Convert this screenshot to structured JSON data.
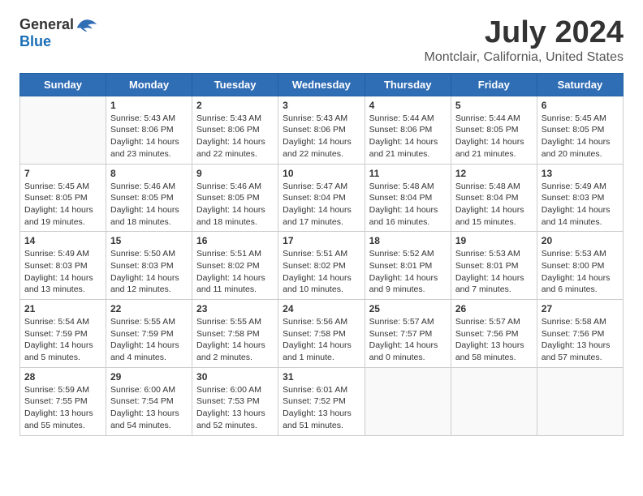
{
  "logo": {
    "general": "General",
    "blue": "Blue"
  },
  "title": "July 2024",
  "location": "Montclair, California, United States",
  "days_of_week": [
    "Sunday",
    "Monday",
    "Tuesday",
    "Wednesday",
    "Thursday",
    "Friday",
    "Saturday"
  ],
  "weeks": [
    [
      {
        "day": "",
        "info": ""
      },
      {
        "day": "1",
        "info": "Sunrise: 5:43 AM\nSunset: 8:06 PM\nDaylight: 14 hours\nand 23 minutes."
      },
      {
        "day": "2",
        "info": "Sunrise: 5:43 AM\nSunset: 8:06 PM\nDaylight: 14 hours\nand 22 minutes."
      },
      {
        "day": "3",
        "info": "Sunrise: 5:43 AM\nSunset: 8:06 PM\nDaylight: 14 hours\nand 22 minutes."
      },
      {
        "day": "4",
        "info": "Sunrise: 5:44 AM\nSunset: 8:06 PM\nDaylight: 14 hours\nand 21 minutes."
      },
      {
        "day": "5",
        "info": "Sunrise: 5:44 AM\nSunset: 8:05 PM\nDaylight: 14 hours\nand 21 minutes."
      },
      {
        "day": "6",
        "info": "Sunrise: 5:45 AM\nSunset: 8:05 PM\nDaylight: 14 hours\nand 20 minutes."
      }
    ],
    [
      {
        "day": "7",
        "info": "Sunrise: 5:45 AM\nSunset: 8:05 PM\nDaylight: 14 hours\nand 19 minutes."
      },
      {
        "day": "8",
        "info": "Sunrise: 5:46 AM\nSunset: 8:05 PM\nDaylight: 14 hours\nand 18 minutes."
      },
      {
        "day": "9",
        "info": "Sunrise: 5:46 AM\nSunset: 8:05 PM\nDaylight: 14 hours\nand 18 minutes."
      },
      {
        "day": "10",
        "info": "Sunrise: 5:47 AM\nSunset: 8:04 PM\nDaylight: 14 hours\nand 17 minutes."
      },
      {
        "day": "11",
        "info": "Sunrise: 5:48 AM\nSunset: 8:04 PM\nDaylight: 14 hours\nand 16 minutes."
      },
      {
        "day": "12",
        "info": "Sunrise: 5:48 AM\nSunset: 8:04 PM\nDaylight: 14 hours\nand 15 minutes."
      },
      {
        "day": "13",
        "info": "Sunrise: 5:49 AM\nSunset: 8:03 PM\nDaylight: 14 hours\nand 14 minutes."
      }
    ],
    [
      {
        "day": "14",
        "info": "Sunrise: 5:49 AM\nSunset: 8:03 PM\nDaylight: 14 hours\nand 13 minutes."
      },
      {
        "day": "15",
        "info": "Sunrise: 5:50 AM\nSunset: 8:03 PM\nDaylight: 14 hours\nand 12 minutes."
      },
      {
        "day": "16",
        "info": "Sunrise: 5:51 AM\nSunset: 8:02 PM\nDaylight: 14 hours\nand 11 minutes."
      },
      {
        "day": "17",
        "info": "Sunrise: 5:51 AM\nSunset: 8:02 PM\nDaylight: 14 hours\nand 10 minutes."
      },
      {
        "day": "18",
        "info": "Sunrise: 5:52 AM\nSunset: 8:01 PM\nDaylight: 14 hours\nand 9 minutes."
      },
      {
        "day": "19",
        "info": "Sunrise: 5:53 AM\nSunset: 8:01 PM\nDaylight: 14 hours\nand 7 minutes."
      },
      {
        "day": "20",
        "info": "Sunrise: 5:53 AM\nSunset: 8:00 PM\nDaylight: 14 hours\nand 6 minutes."
      }
    ],
    [
      {
        "day": "21",
        "info": "Sunrise: 5:54 AM\nSunset: 7:59 PM\nDaylight: 14 hours\nand 5 minutes."
      },
      {
        "day": "22",
        "info": "Sunrise: 5:55 AM\nSunset: 7:59 PM\nDaylight: 14 hours\nand 4 minutes."
      },
      {
        "day": "23",
        "info": "Sunrise: 5:55 AM\nSunset: 7:58 PM\nDaylight: 14 hours\nand 2 minutes."
      },
      {
        "day": "24",
        "info": "Sunrise: 5:56 AM\nSunset: 7:58 PM\nDaylight: 14 hours\nand 1 minute."
      },
      {
        "day": "25",
        "info": "Sunrise: 5:57 AM\nSunset: 7:57 PM\nDaylight: 14 hours\nand 0 minutes."
      },
      {
        "day": "26",
        "info": "Sunrise: 5:57 AM\nSunset: 7:56 PM\nDaylight: 13 hours\nand 58 minutes."
      },
      {
        "day": "27",
        "info": "Sunrise: 5:58 AM\nSunset: 7:56 PM\nDaylight: 13 hours\nand 57 minutes."
      }
    ],
    [
      {
        "day": "28",
        "info": "Sunrise: 5:59 AM\nSunset: 7:55 PM\nDaylight: 13 hours\nand 55 minutes."
      },
      {
        "day": "29",
        "info": "Sunrise: 6:00 AM\nSunset: 7:54 PM\nDaylight: 13 hours\nand 54 minutes."
      },
      {
        "day": "30",
        "info": "Sunrise: 6:00 AM\nSunset: 7:53 PM\nDaylight: 13 hours\nand 52 minutes."
      },
      {
        "day": "31",
        "info": "Sunrise: 6:01 AM\nSunset: 7:52 PM\nDaylight: 13 hours\nand 51 minutes."
      },
      {
        "day": "",
        "info": ""
      },
      {
        "day": "",
        "info": ""
      },
      {
        "day": "",
        "info": ""
      }
    ]
  ]
}
